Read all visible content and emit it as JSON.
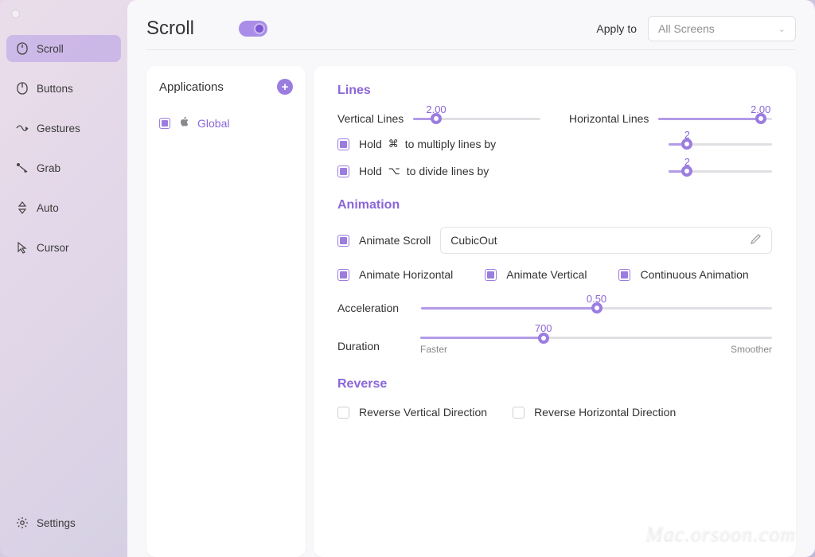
{
  "sidebar": {
    "items": [
      {
        "label": "Scroll"
      },
      {
        "label": "Buttons"
      },
      {
        "label": "Gestures"
      },
      {
        "label": "Grab"
      },
      {
        "label": "Auto"
      },
      {
        "label": "Cursor"
      }
    ],
    "settings_label": "Settings"
  },
  "header": {
    "title": "Scroll",
    "apply_to_label": "Apply to",
    "apply_to_value": "All Screens"
  },
  "apps": {
    "title": "Applications",
    "global_label": "Global"
  },
  "lines": {
    "title": "Lines",
    "vertical_label": "Vertical Lines",
    "vertical_value": "2.00",
    "horizontal_label": "Horizontal Lines",
    "horizontal_value": "2.00",
    "hold_multiply_label_pre": "Hold",
    "hold_multiply_sym": "⌘",
    "hold_multiply_label_post": "to multiply lines by",
    "hold_multiply_value": "2",
    "hold_divide_label_pre": "Hold",
    "hold_divide_sym": "⌥",
    "hold_divide_label_post": "to divide lines by",
    "hold_divide_value": "2"
  },
  "animation": {
    "title": "Animation",
    "scroll_label": "Animate Scroll",
    "scroll_value": "CubicOut",
    "horizontal_label": "Animate Horizontal",
    "vertical_label": "Animate Vertical",
    "continuous_label": "Continuous Animation",
    "acceleration_label": "Acceleration",
    "acceleration_value": "0.50",
    "duration_label": "Duration",
    "duration_value": "700",
    "faster_label": "Faster",
    "smoother_label": "Smoother"
  },
  "reverse": {
    "title": "Reverse",
    "vertical_label": "Reverse Vertical Direction",
    "horizontal_label": "Reverse Horizontal Direction"
  },
  "watermark": "Mac.orsoon.com"
}
